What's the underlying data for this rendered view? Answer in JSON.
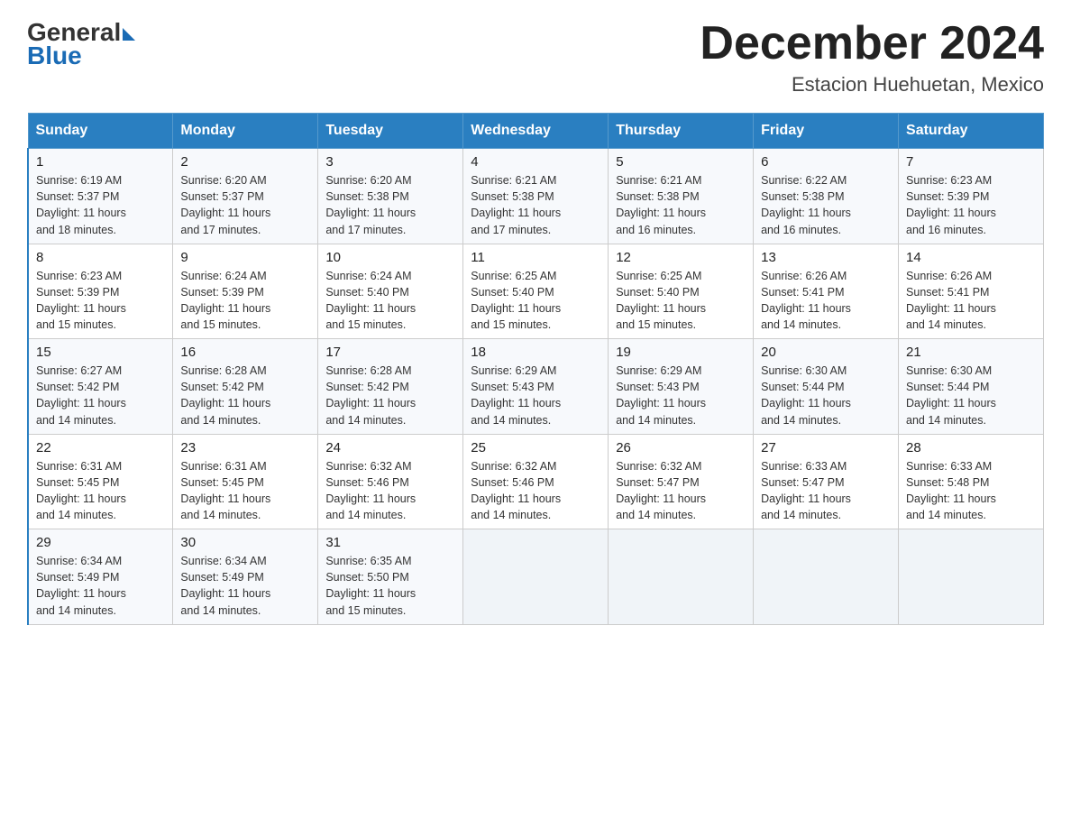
{
  "header": {
    "logo_general": "General",
    "logo_blue": "Blue",
    "month_title": "December 2024",
    "location": "Estacion Huehuetan, Mexico"
  },
  "weekdays": [
    "Sunday",
    "Monday",
    "Tuesday",
    "Wednesday",
    "Thursday",
    "Friday",
    "Saturday"
  ],
  "weeks": [
    [
      {
        "day": "1",
        "sunrise": "6:19 AM",
        "sunset": "5:37 PM",
        "daylight": "11 hours and 18 minutes."
      },
      {
        "day": "2",
        "sunrise": "6:20 AM",
        "sunset": "5:37 PM",
        "daylight": "11 hours and 17 minutes."
      },
      {
        "day": "3",
        "sunrise": "6:20 AM",
        "sunset": "5:38 PM",
        "daylight": "11 hours and 17 minutes."
      },
      {
        "day": "4",
        "sunrise": "6:21 AM",
        "sunset": "5:38 PM",
        "daylight": "11 hours and 17 minutes."
      },
      {
        "day": "5",
        "sunrise": "6:21 AM",
        "sunset": "5:38 PM",
        "daylight": "11 hours and 16 minutes."
      },
      {
        "day": "6",
        "sunrise": "6:22 AM",
        "sunset": "5:38 PM",
        "daylight": "11 hours and 16 minutes."
      },
      {
        "day": "7",
        "sunrise": "6:23 AM",
        "sunset": "5:39 PM",
        "daylight": "11 hours and 16 minutes."
      }
    ],
    [
      {
        "day": "8",
        "sunrise": "6:23 AM",
        "sunset": "5:39 PM",
        "daylight": "11 hours and 15 minutes."
      },
      {
        "day": "9",
        "sunrise": "6:24 AM",
        "sunset": "5:39 PM",
        "daylight": "11 hours and 15 minutes."
      },
      {
        "day": "10",
        "sunrise": "6:24 AM",
        "sunset": "5:40 PM",
        "daylight": "11 hours and 15 minutes."
      },
      {
        "day": "11",
        "sunrise": "6:25 AM",
        "sunset": "5:40 PM",
        "daylight": "11 hours and 15 minutes."
      },
      {
        "day": "12",
        "sunrise": "6:25 AM",
        "sunset": "5:40 PM",
        "daylight": "11 hours and 15 minutes."
      },
      {
        "day": "13",
        "sunrise": "6:26 AM",
        "sunset": "5:41 PM",
        "daylight": "11 hours and 14 minutes."
      },
      {
        "day": "14",
        "sunrise": "6:26 AM",
        "sunset": "5:41 PM",
        "daylight": "11 hours and 14 minutes."
      }
    ],
    [
      {
        "day": "15",
        "sunrise": "6:27 AM",
        "sunset": "5:42 PM",
        "daylight": "11 hours and 14 minutes."
      },
      {
        "day": "16",
        "sunrise": "6:28 AM",
        "sunset": "5:42 PM",
        "daylight": "11 hours and 14 minutes."
      },
      {
        "day": "17",
        "sunrise": "6:28 AM",
        "sunset": "5:42 PM",
        "daylight": "11 hours and 14 minutes."
      },
      {
        "day": "18",
        "sunrise": "6:29 AM",
        "sunset": "5:43 PM",
        "daylight": "11 hours and 14 minutes."
      },
      {
        "day": "19",
        "sunrise": "6:29 AM",
        "sunset": "5:43 PM",
        "daylight": "11 hours and 14 minutes."
      },
      {
        "day": "20",
        "sunrise": "6:30 AM",
        "sunset": "5:44 PM",
        "daylight": "11 hours and 14 minutes."
      },
      {
        "day": "21",
        "sunrise": "6:30 AM",
        "sunset": "5:44 PM",
        "daylight": "11 hours and 14 minutes."
      }
    ],
    [
      {
        "day": "22",
        "sunrise": "6:31 AM",
        "sunset": "5:45 PM",
        "daylight": "11 hours and 14 minutes."
      },
      {
        "day": "23",
        "sunrise": "6:31 AM",
        "sunset": "5:45 PM",
        "daylight": "11 hours and 14 minutes."
      },
      {
        "day": "24",
        "sunrise": "6:32 AM",
        "sunset": "5:46 PM",
        "daylight": "11 hours and 14 minutes."
      },
      {
        "day": "25",
        "sunrise": "6:32 AM",
        "sunset": "5:46 PM",
        "daylight": "11 hours and 14 minutes."
      },
      {
        "day": "26",
        "sunrise": "6:32 AM",
        "sunset": "5:47 PM",
        "daylight": "11 hours and 14 minutes."
      },
      {
        "day": "27",
        "sunrise": "6:33 AM",
        "sunset": "5:47 PM",
        "daylight": "11 hours and 14 minutes."
      },
      {
        "day": "28",
        "sunrise": "6:33 AM",
        "sunset": "5:48 PM",
        "daylight": "11 hours and 14 minutes."
      }
    ],
    [
      {
        "day": "29",
        "sunrise": "6:34 AM",
        "sunset": "5:49 PM",
        "daylight": "11 hours and 14 minutes."
      },
      {
        "day": "30",
        "sunrise": "6:34 AM",
        "sunset": "5:49 PM",
        "daylight": "11 hours and 14 minutes."
      },
      {
        "day": "31",
        "sunrise": "6:35 AM",
        "sunset": "5:50 PM",
        "daylight": "11 hours and 15 minutes."
      },
      null,
      null,
      null,
      null
    ]
  ],
  "labels": {
    "sunrise": "Sunrise:",
    "sunset": "Sunset:",
    "daylight": "Daylight:"
  }
}
